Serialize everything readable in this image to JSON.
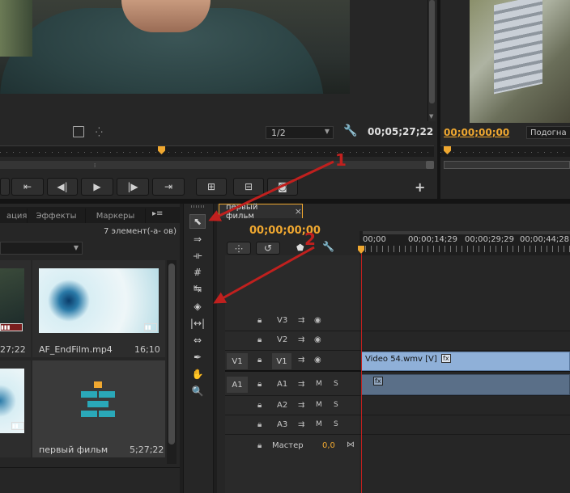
{
  "source_monitor": {
    "zoom": "1/2",
    "timecode": "00;05;27;22"
  },
  "program_monitor": {
    "timecode": "00;00;00;00",
    "fit_label": "Подогна"
  },
  "project_panel": {
    "tabs": [
      "ация",
      "Эффекты",
      "Маркеры"
    ],
    "item_count": "7 элемент(-а- ов)",
    "items": [
      {
        "name": "",
        "duration": "27;22"
      },
      {
        "name": "AF_EndFilm.mp4",
        "duration": "16;10"
      },
      {
        "name": "",
        "duration": ""
      },
      {
        "name": "первый фильм",
        "duration": "5;27;22"
      }
    ]
  },
  "timeline": {
    "tab_label": "первый фильм",
    "close": "×",
    "timecode": "00;00;00;00",
    "ruler": [
      "00;00",
      "00;00;14;29",
      "00;00;29;29",
      "00;00;44;28"
    ],
    "video_tracks": [
      {
        "source": "",
        "name": "V3"
      },
      {
        "source": "",
        "name": "V2"
      },
      {
        "source": "V1",
        "name": "V1"
      }
    ],
    "audio_tracks": [
      {
        "source": "A1",
        "name": "A1"
      },
      {
        "source": "",
        "name": "A2"
      },
      {
        "source": "",
        "name": "A3"
      }
    ],
    "mute": "M",
    "solo": "S",
    "master_label": "Мастер",
    "master_value": "0,0",
    "clip_label": "Video 54.wmv [V]",
    "fx": "fx"
  },
  "annotations": {
    "one": "1",
    "two": "2"
  },
  "colors": {
    "accent": "#f0a830",
    "clip_video": "#8fb0d8",
    "clip_audio": "#5a6f88",
    "arrow": "#c0201e"
  }
}
